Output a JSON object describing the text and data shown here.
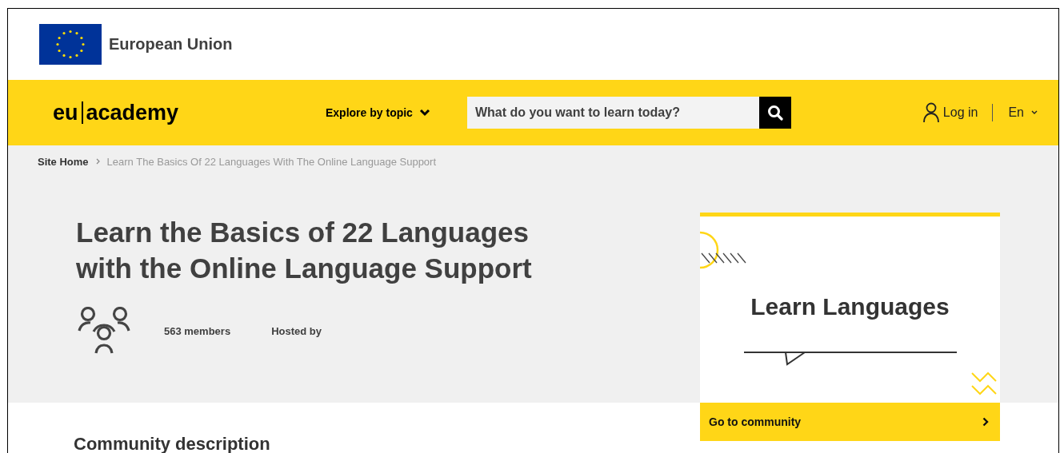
{
  "header": {
    "org_name": "European Union"
  },
  "nav": {
    "logo": {
      "left": "eu",
      "right": "academy"
    },
    "explore": "Explore by topic",
    "search": {
      "placeholder": "What do you want to learn today?"
    },
    "login": "Log in",
    "language": "En"
  },
  "breadcrumb": [
    {
      "label": "Site Home",
      "current": false
    },
    {
      "label": "Learn The Basics Of 22 Languages With The Online Language Support",
      "current": true
    }
  ],
  "community": {
    "title": "Learn the Basics of 22 Languages with the Online Language Support",
    "members": "563 members",
    "hosted_by": "Hosted by"
  },
  "card": {
    "image_title": "Learn Languages",
    "action": "Go to community"
  },
  "section_heading": "Community description"
}
